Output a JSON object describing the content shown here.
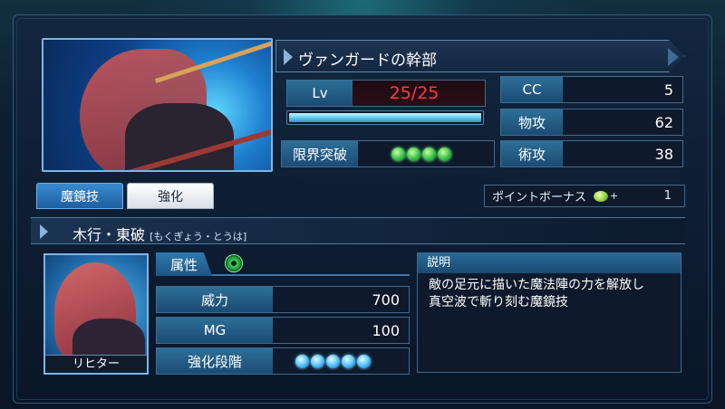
{
  "character": {
    "name": "ヴァンガードの幹部",
    "level_label": "Lv",
    "level_value": "25/25",
    "exp_fraction": 1.0,
    "limit_break_label": "限界突破",
    "limit_break_count": 4,
    "stats": [
      {
        "label": "CC",
        "value": "5"
      },
      {
        "label": "物攻",
        "value": "62"
      },
      {
        "label": "術攻",
        "value": "38"
      }
    ]
  },
  "tabs": [
    {
      "label": "魔鏡技",
      "active": true
    },
    {
      "label": "強化",
      "active": false
    }
  ],
  "point_bonus": {
    "label": "ポイントボーナス",
    "plus": "+",
    "value": "1"
  },
  "skill": {
    "name": "木行・東破",
    "reading": "[もくぎょう・とうは]",
    "character_caption": "リヒター",
    "attribute_label": "属性",
    "attribute_icon": "wood-element-icon",
    "power_label": "威力",
    "power_value": "700",
    "mg_label": "MG",
    "mg_value": "100",
    "enhance_label": "強化段階",
    "enhance_count": 5,
    "desc_label": "説明",
    "desc_line1": "敵の足元に描いた魔法陣の力を解放し",
    "desc_line2": "真空波で斬り刻む魔鏡技"
  }
}
